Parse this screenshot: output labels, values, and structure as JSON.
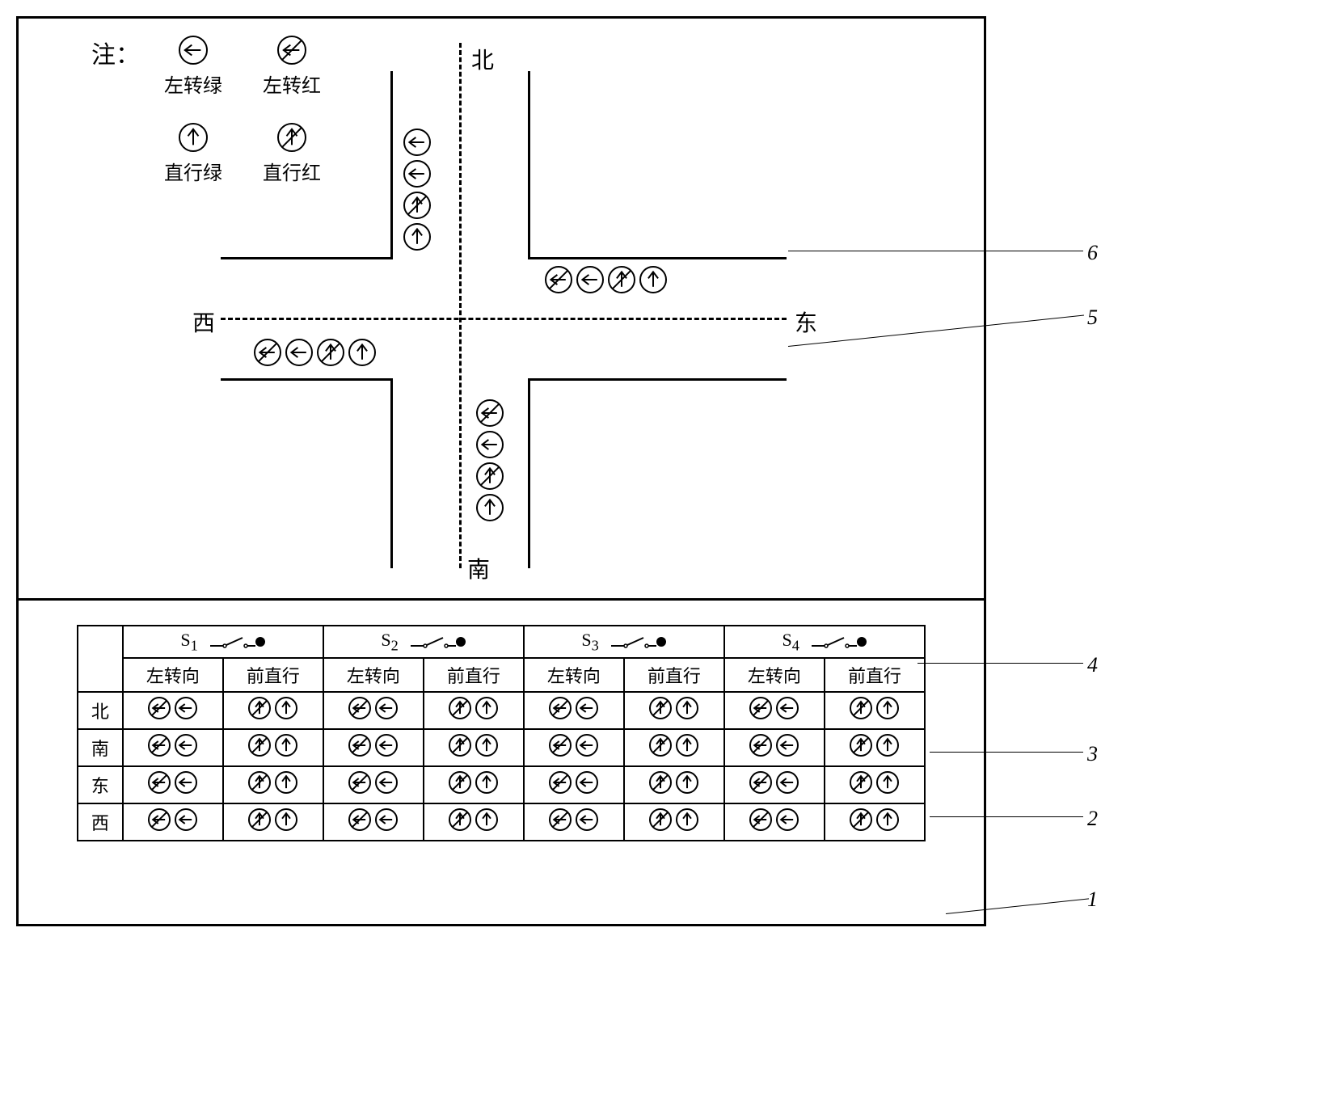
{
  "legend": {
    "title": "注：",
    "items": [
      {
        "id": "left-green",
        "label": "左转绿",
        "type": "left",
        "mode": "green"
      },
      {
        "id": "left-red",
        "label": "左转红",
        "type": "left",
        "mode": "red"
      },
      {
        "id": "straight-green",
        "label": "直行绿",
        "type": "straight",
        "mode": "green"
      },
      {
        "id": "straight-red",
        "label": "直行红",
        "type": "straight",
        "mode": "red"
      }
    ]
  },
  "directions": {
    "north": "北",
    "south": "南",
    "east": "东",
    "west": "西"
  },
  "intersection_signals": {
    "north": [
      "left-green",
      "left-green",
      "straight-red",
      "straight-green"
    ],
    "east": [
      "left-red",
      "left-green",
      "straight-red",
      "straight-green"
    ],
    "south": [
      "left-red",
      "left-green",
      "straight-red",
      "straight-green"
    ],
    "west": [
      "left-red",
      "left-green",
      "straight-red",
      "straight-green"
    ]
  },
  "phases": [
    {
      "id": "S1",
      "label": "S",
      "sub": "1"
    },
    {
      "id": "S2",
      "label": "S",
      "sub": "2"
    },
    {
      "id": "S3",
      "label": "S",
      "sub": "3"
    },
    {
      "id": "S4",
      "label": "S",
      "sub": "4"
    }
  ],
  "sub_headers": {
    "left_turn": "左转向",
    "straight": "前直行"
  },
  "table_rows": {
    "directions": [
      "北",
      "南",
      "东",
      "西"
    ],
    "cells": {
      "北": {
        "S1": {
          "left": [
            "left-red",
            "left-green"
          ],
          "straight": [
            "straight-red",
            "straight-green"
          ]
        },
        "S2": {
          "left": [
            "left-red",
            "left-green"
          ],
          "straight": [
            "straight-red",
            "straight-green"
          ]
        },
        "S3": {
          "left": [
            "left-red",
            "left-green"
          ],
          "straight": [
            "straight-red",
            "straight-green"
          ]
        },
        "S4": {
          "left": [
            "left-red",
            "left-green"
          ],
          "straight": [
            "straight-red",
            "straight-green"
          ]
        }
      },
      "南": {
        "S1": {
          "left": [
            "left-red",
            "left-green"
          ],
          "straight": [
            "straight-red",
            "straight-green"
          ]
        },
        "S2": {
          "left": [
            "left-red",
            "left-green"
          ],
          "straight": [
            "straight-red",
            "straight-green"
          ]
        },
        "S3": {
          "left": [
            "left-red",
            "left-green"
          ],
          "straight": [
            "straight-red",
            "straight-green"
          ]
        },
        "S4": {
          "left": [
            "left-red",
            "left-green"
          ],
          "straight": [
            "straight-red",
            "straight-green"
          ]
        }
      },
      "东": {
        "S1": {
          "left": [
            "left-red",
            "left-green"
          ],
          "straight": [
            "straight-red",
            "straight-green"
          ]
        },
        "S2": {
          "left": [
            "left-red",
            "left-green"
          ],
          "straight": [
            "straight-red",
            "straight-green"
          ]
        },
        "S3": {
          "left": [
            "left-red",
            "left-green"
          ],
          "straight": [
            "straight-red",
            "straight-green"
          ]
        },
        "S4": {
          "left": [
            "left-red",
            "left-green"
          ],
          "straight": [
            "straight-red",
            "straight-green"
          ]
        }
      },
      "西": {
        "S1": {
          "left": [
            "left-red",
            "left-green"
          ],
          "straight": [
            "straight-red",
            "straight-green"
          ]
        },
        "S2": {
          "left": [
            "left-red",
            "left-green"
          ],
          "straight": [
            "straight-red",
            "straight-green"
          ]
        },
        "S3": {
          "left": [
            "left-red",
            "left-green"
          ],
          "straight": [
            "straight-red",
            "straight-green"
          ]
        },
        "S4": {
          "left": [
            "left-red",
            "left-green"
          ],
          "straight": [
            "straight-red",
            "straight-green"
          ]
        }
      }
    }
  },
  "callouts": {
    "1": "1",
    "2": "2",
    "3": "3",
    "4": "4",
    "5": "5",
    "6": "6"
  }
}
